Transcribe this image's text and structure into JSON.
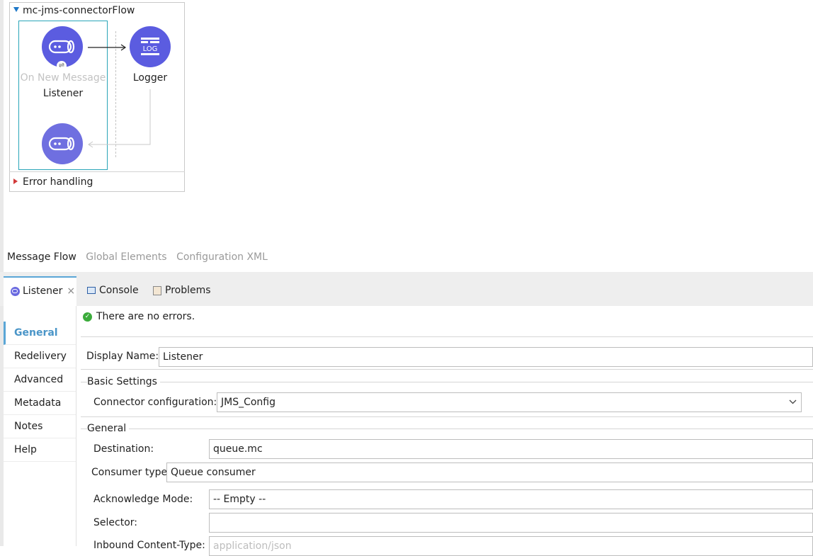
{
  "flow": {
    "title": "mc-jms-connectorFlow",
    "source_label_top": "On New Message",
    "source_label_bottom": "Listener",
    "logger_label": "Logger",
    "logger_icon_text": "LOG",
    "error_handling": "Error handling"
  },
  "editor_tabs": [
    {
      "label": "Message Flow",
      "active": true
    },
    {
      "label": "Global Elements",
      "active": false
    },
    {
      "label": "Configuration XML",
      "active": false
    }
  ],
  "panel": {
    "listener_tab": "Listener",
    "close_glyph": "×",
    "console_tab": "Console",
    "problems_tab": "Problems",
    "status": "There are no errors.",
    "nav": [
      "General",
      "Redelivery",
      "Advanced",
      "Metadata",
      "Notes",
      "Help"
    ],
    "active_nav": "General"
  },
  "form": {
    "display_name_label": "Display Name:",
    "display_name_value": "Listener",
    "basic_settings_title": "Basic Settings",
    "connector_config_label": "Connector configuration:",
    "connector_config_value": "JMS_Config",
    "general_title": "General",
    "destination_label": "Destination:",
    "destination_value": "queue.mc",
    "consumer_type_label": "Consumer type",
    "consumer_type_value": "Queue consumer",
    "ack_mode_label": "Acknowledge Mode:",
    "ack_mode_value": "-- Empty --",
    "selector_label": "Selector:",
    "selector_value": "",
    "inbound_content_type_label": "Inbound Content-Type:",
    "inbound_content_type_placeholder": "application/json"
  },
  "colors": {
    "node": "#5b5ce0",
    "accent": "#5aa6d6",
    "selection": "#2aa5b8",
    "ok": "#3bab3b",
    "error_triangle": "#d23a3a"
  }
}
